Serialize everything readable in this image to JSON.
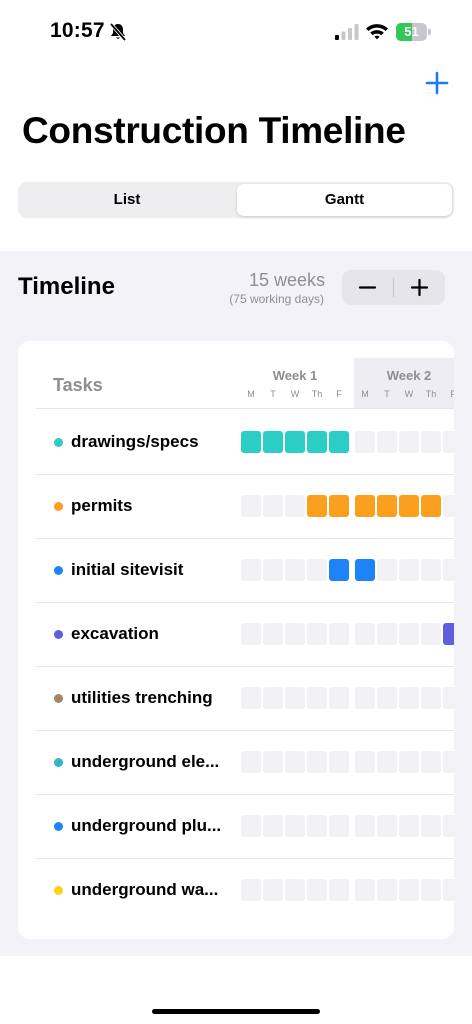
{
  "status_bar": {
    "time": "10:57",
    "battery_level": "51",
    "battery_fraction": 0.51,
    "battery_color": "#34c759"
  },
  "header": {
    "title": "Construction Timeline"
  },
  "segments": [
    {
      "label": "List",
      "selected": false
    },
    {
      "label": "Gantt",
      "selected": true
    }
  ],
  "timeline": {
    "heading": "Timeline",
    "weeks": "15 weeks",
    "working_days": "(75 working days)"
  },
  "gantt": {
    "tasks_header": "Tasks",
    "weeks": [
      {
        "label": "Week 1",
        "days": [
          "M",
          "T",
          "W",
          "Th",
          "F"
        ]
      },
      {
        "label": "Week 2",
        "days": [
          "M",
          "T",
          "W",
          "Th",
          "F"
        ]
      }
    ],
    "tasks": [
      {
        "name": "drawings/specs",
        "color": "#2ccdc4",
        "active_days": [
          1,
          2,
          3,
          4,
          5
        ]
      },
      {
        "name": "permits",
        "color": "#fa9f1e",
        "active_days": [
          4,
          5,
          6,
          7,
          8,
          9
        ]
      },
      {
        "name": "initial sitevisit",
        "color": "#1f83f8",
        "active_days": [
          5,
          6
        ]
      },
      {
        "name": "excavation",
        "color": "#5f5fdb",
        "active_days": [
          10
        ]
      },
      {
        "name": "utilities trenching",
        "color": "#a28566",
        "active_days": []
      },
      {
        "name": "underground ele...",
        "color": "#33b3c8",
        "active_days": []
      },
      {
        "name": "underground plu...",
        "color": "#1f83f8",
        "active_days": []
      },
      {
        "name": "underground wa...",
        "color": "#f8d31a",
        "active_days": []
      }
    ]
  }
}
